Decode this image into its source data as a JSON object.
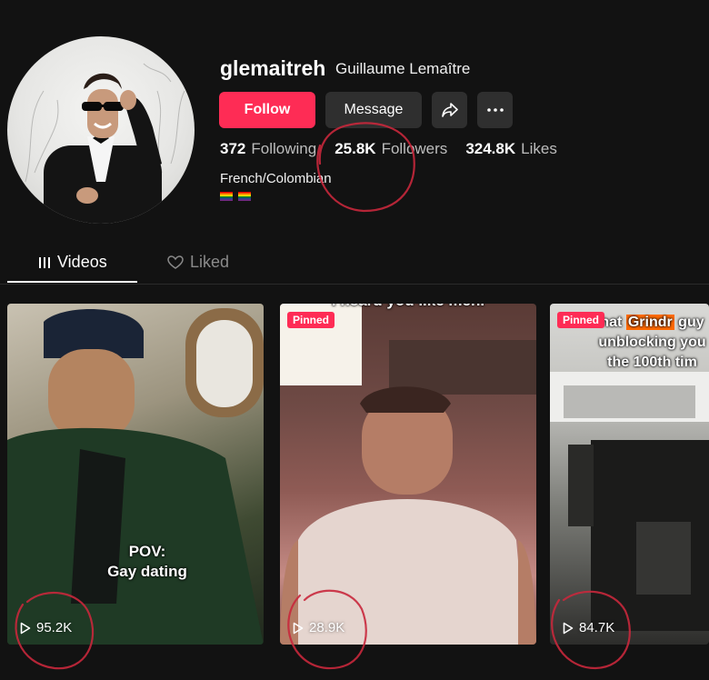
{
  "profile": {
    "username": "glemaitreh",
    "display_name": "Guillaume Lemaître",
    "bio": "French/Colombian",
    "avatar_icon": "avatar-photo"
  },
  "actions": {
    "follow_label": "Follow",
    "message_label": "Message",
    "share_icon": "share-icon",
    "more_icon": "more-icon"
  },
  "stats": {
    "following_count": "372",
    "following_label": "Following",
    "followers_count": "25.8K",
    "followers_label": "Followers",
    "likes_count": "324.8K",
    "likes_label": "Likes"
  },
  "tabs": [
    {
      "label": "Videos",
      "active": true
    },
    {
      "label": "Liked",
      "active": false
    }
  ],
  "videos": [
    {
      "views": "95.2K",
      "pinned": false,
      "caption": "POV:\nGay dating"
    },
    {
      "views": "28.9K",
      "pinned": true,
      "pinned_label": "Pinned",
      "caption": "I heard you like men."
    },
    {
      "views": "84.7K",
      "pinned": true,
      "pinned_label": "Pinned",
      "caption_pre": "hat ",
      "caption_highlight": "Grindr",
      "caption_post": " guy unblocking you the 100th tim"
    }
  ],
  "colors": {
    "accent": "#fe2c55",
    "background": "#121212",
    "button_dark": "#2f2f2f",
    "annotation_red": "#c8283c"
  }
}
